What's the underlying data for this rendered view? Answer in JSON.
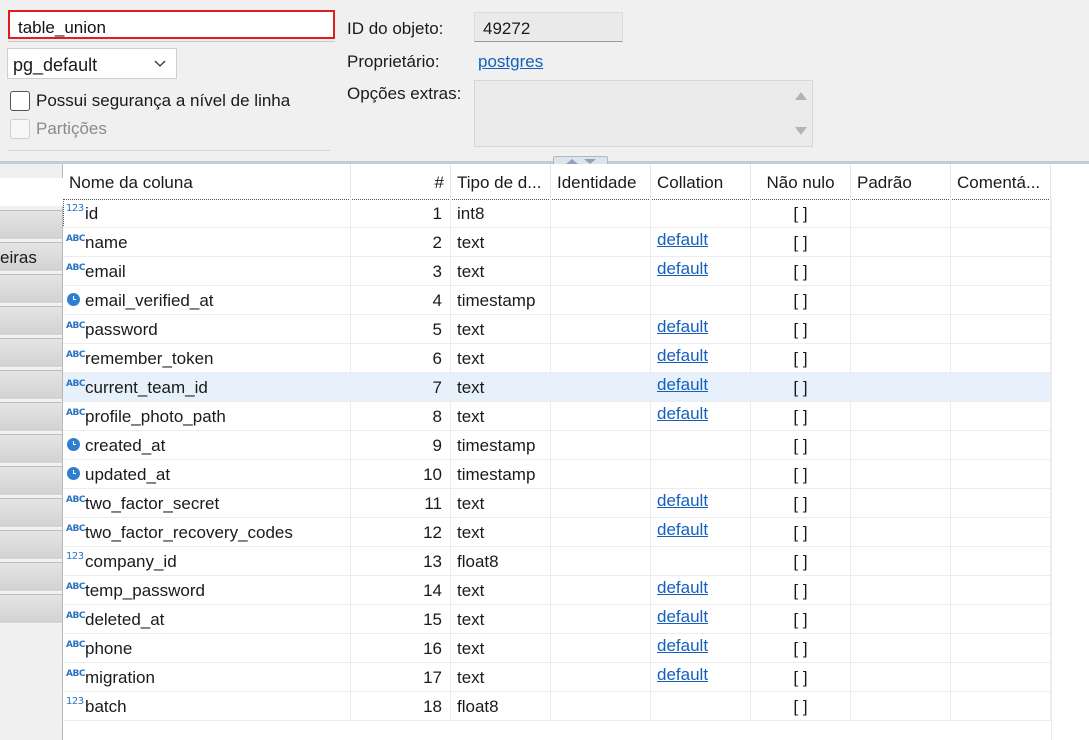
{
  "table_name": "table_union",
  "tablespace": "pg_default",
  "row_security_label": "Possui segurança a nível de linha",
  "partitions_label": "Partições",
  "object_id_label": "ID do objeto:",
  "object_id_value": "49272",
  "owner_label": "Proprietário:",
  "owner_value": "postgres",
  "extra_options_label": "Opções extras:",
  "side_tab_label": "eiras",
  "columns_header": {
    "name": "Nome da coluna",
    "num": "#",
    "type": "Tipo de d...",
    "identity": "Identidade",
    "collation": "Collation",
    "not_null": "Não nulo",
    "default": "Padrão",
    "comment": "Comentá..."
  },
  "columns": [
    {
      "icon": "numeric-icon",
      "name": "id",
      "num": "1",
      "type": "int8",
      "collation": "",
      "not_null": "[ ]"
    },
    {
      "icon": "text-icon",
      "name": "name",
      "num": "2",
      "type": "text",
      "collation": "default",
      "not_null": "[ ]"
    },
    {
      "icon": "text-icon",
      "name": "email",
      "num": "3",
      "type": "text",
      "collation": "default",
      "not_null": "[ ]"
    },
    {
      "icon": "clock-icon",
      "name": "email_verified_at",
      "num": "4",
      "type": "timestamp",
      "collation": "",
      "not_null": "[ ]"
    },
    {
      "icon": "text-icon",
      "name": "password",
      "num": "5",
      "type": "text",
      "collation": "default",
      "not_null": "[ ]"
    },
    {
      "icon": "text-icon",
      "name": "remember_token",
      "num": "6",
      "type": "text",
      "collation": "default",
      "not_null": "[ ]"
    },
    {
      "icon": "text-icon",
      "name": "current_team_id",
      "num": "7",
      "type": "text",
      "collation": "default",
      "not_null": "[ ]"
    },
    {
      "icon": "text-icon",
      "name": "profile_photo_path",
      "num": "8",
      "type": "text",
      "collation": "default",
      "not_null": "[ ]"
    },
    {
      "icon": "clock-icon",
      "name": "created_at",
      "num": "9",
      "type": "timestamp",
      "collation": "",
      "not_null": "[ ]"
    },
    {
      "icon": "clock-icon",
      "name": "updated_at",
      "num": "10",
      "type": "timestamp",
      "collation": "",
      "not_null": "[ ]"
    },
    {
      "icon": "text-icon",
      "name": "two_factor_secret",
      "num": "11",
      "type": "text",
      "collation": "default",
      "not_null": "[ ]"
    },
    {
      "icon": "text-icon",
      "name": "two_factor_recovery_codes",
      "num": "12",
      "type": "text",
      "collation": "default",
      "not_null": "[ ]"
    },
    {
      "icon": "numeric-icon",
      "name": "company_id",
      "num": "13",
      "type": "float8",
      "collation": "",
      "not_null": "[ ]"
    },
    {
      "icon": "text-icon",
      "name": "temp_password",
      "num": "14",
      "type": "text",
      "collation": "default",
      "not_null": "[ ]"
    },
    {
      "icon": "text-icon",
      "name": "deleted_at",
      "num": "15",
      "type": "text",
      "collation": "default",
      "not_null": "[ ]"
    },
    {
      "icon": "text-icon",
      "name": "phone",
      "num": "16",
      "type": "text",
      "collation": "default",
      "not_null": "[ ]"
    },
    {
      "icon": "text-icon",
      "name": "migration",
      "num": "17",
      "type": "text",
      "collation": "default",
      "not_null": "[ ]"
    },
    {
      "icon": "numeric-icon",
      "name": "batch",
      "num": "18",
      "type": "float8",
      "collation": "",
      "not_null": "[ ]"
    }
  ],
  "selected_row": 6,
  "focused_row": 0,
  "icon_glyphs": {
    "text-icon": "ABC",
    "numeric-icon": "123",
    "clock-icon": ""
  },
  "colors": {
    "accent_link": "#1560bd",
    "selection": "#e6f1fb",
    "focus_border": "#e01e1e"
  }
}
